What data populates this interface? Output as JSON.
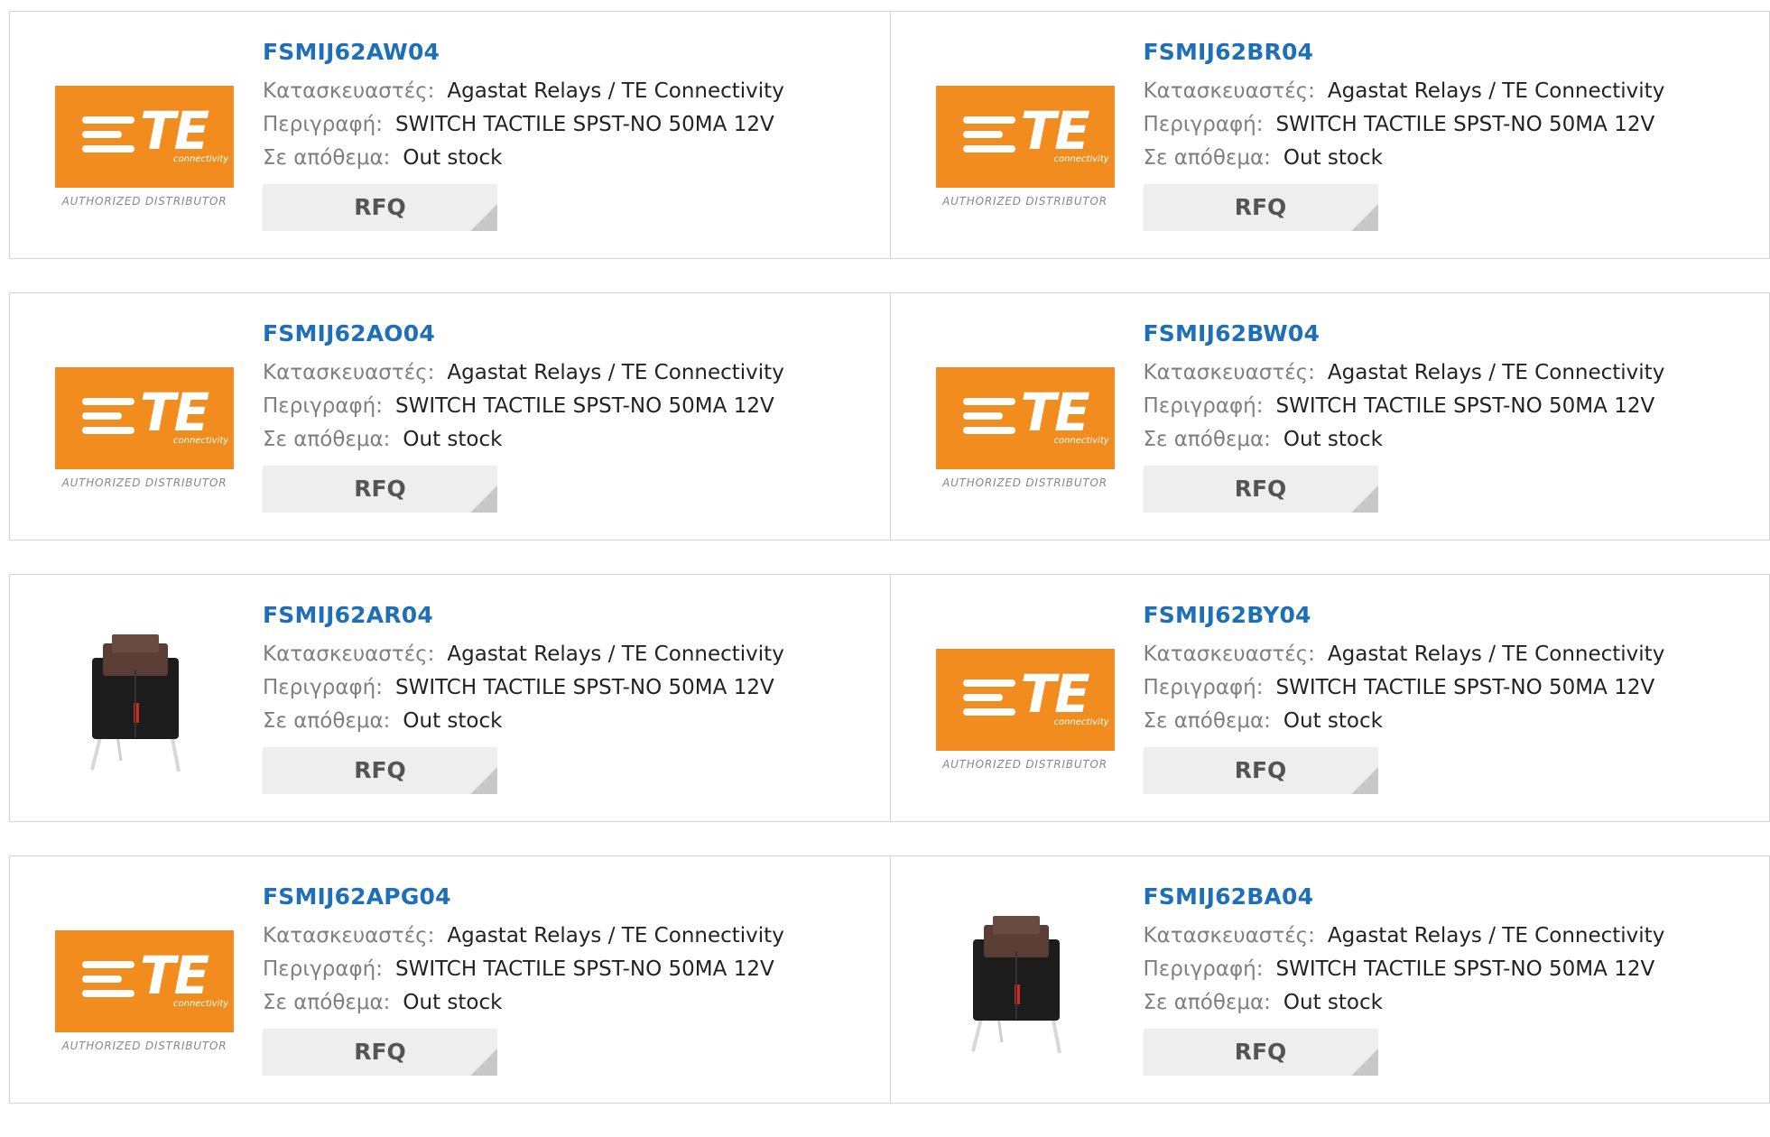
{
  "labels": {
    "manufacturer": "Κατασκευαστές:",
    "description": "Περιγραφή:",
    "stock": "Σε απόθεμα:",
    "rfq": "RFQ"
  },
  "logo": {
    "brand": "TE",
    "sub": "connectivity",
    "caption": "AUTHORIZED DISTRIBUTOR",
    "color": "#f28c1e"
  },
  "products": [
    {
      "part": "FSMIJ62AW04",
      "manufacturer": "Agastat Relays / TE Connectivity",
      "description": "SWITCH TACTILE SPST-NO 50MA 12V",
      "stock": "Out stock",
      "image": "te-logo"
    },
    {
      "part": "FSMIJ62BR04",
      "manufacturer": "Agastat Relays / TE Connectivity",
      "description": "SWITCH TACTILE SPST-NO 50MA 12V",
      "stock": "Out stock",
      "image": "te-logo"
    },
    {
      "part": "FSMIJ62AO04",
      "manufacturer": "Agastat Relays / TE Connectivity",
      "description": "SWITCH TACTILE SPST-NO 50MA 12V",
      "stock": "Out stock",
      "image": "te-logo"
    },
    {
      "part": "FSMIJ62BW04",
      "manufacturer": "Agastat Relays / TE Connectivity",
      "description": "SWITCH TACTILE SPST-NO 50MA 12V",
      "stock": "Out stock",
      "image": "te-logo"
    },
    {
      "part": "FSMIJ62AR04",
      "manufacturer": "Agastat Relays / TE Connectivity",
      "description": "SWITCH TACTILE SPST-NO 50MA 12V",
      "stock": "Out stock",
      "image": "switch-photo"
    },
    {
      "part": "FSMIJ62BY04",
      "manufacturer": "Agastat Relays / TE Connectivity",
      "description": "SWITCH TACTILE SPST-NO 50MA 12V",
      "stock": "Out stock",
      "image": "te-logo"
    },
    {
      "part": "FSMIJ62APG04",
      "manufacturer": "Agastat Relays / TE Connectivity",
      "description": "SWITCH TACTILE SPST-NO 50MA 12V",
      "stock": "Out stock",
      "image": "te-logo"
    },
    {
      "part": "FSMIJ62BA04",
      "manufacturer": "Agastat Relays / TE Connectivity",
      "description": "SWITCH TACTILE SPST-NO 50MA 12V",
      "stock": "Out stock",
      "image": "switch-photo"
    }
  ]
}
